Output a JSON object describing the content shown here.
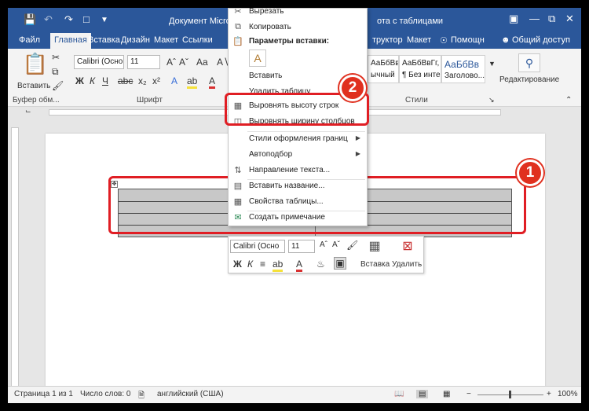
{
  "titlebar": {
    "title_left": "Документ Microsoft Word",
    "title_right": "а с таблицами",
    "tools_prefix": "ота с таблицами"
  },
  "tabs": {
    "file": "Файл",
    "home": "Главная",
    "insert": "Вставка",
    "design": "Дизайн",
    "layout": "Макет",
    "refs": "Ссылки",
    "constructor": "труктор",
    "layout2": "Макет",
    "help": "Помощн",
    "share": "Общий доступ"
  },
  "ribbon": {
    "paste_label": "Вставить",
    "clipboard_group": "Буфер обм...",
    "font_group": "Шрифт",
    "styles_group": "Стили",
    "font_name": "Calibri (Осно",
    "font_size": "11",
    "styles": [
      {
        "preview": "АаБбВвГг,",
        "name": "ычный"
      },
      {
        "preview": "АаБбВвГг,",
        "name": "¶ Без инте..."
      },
      {
        "preview": "АаБбВв",
        "name": "Заголово..."
      }
    ],
    "edit_label": "Редактирование"
  },
  "context_menu": {
    "items": [
      {
        "icon": "scissors-icon",
        "label": "Вырезать"
      },
      {
        "icon": "copy-icon",
        "label": "Копировать"
      },
      {
        "icon": "paste-icon",
        "label": "Параметры вставки:"
      },
      {
        "icon": "paste-option-icon",
        "label": "A"
      },
      {
        "icon": "",
        "label": "Вставить"
      },
      {
        "icon": "",
        "label": "Удалить таблицу"
      },
      {
        "icon": "equal-rows-icon",
        "label": "Выровнять высоту строк"
      },
      {
        "icon": "equal-cols-icon",
        "label": "Выровнять ширину столбцов"
      },
      {
        "icon": "",
        "label": "Стили оформления границ"
      },
      {
        "icon": "",
        "label": "Автоподбор"
      },
      {
        "icon": "text-direction-icon",
        "label": "Направление текста..."
      },
      {
        "icon": "insert-caption-icon",
        "label": "Вставить название..."
      },
      {
        "icon": "table-props-icon",
        "label": "Свойства таблицы..."
      },
      {
        "icon": "comment-icon",
        "label": "Создать примечание"
      }
    ]
  },
  "mini_toolbar": {
    "font_name": "Calibri (Осно",
    "font_size": "11",
    "insert_label": "Вставка",
    "delete_label": "Удалить"
  },
  "callouts": {
    "one": "1",
    "two": "2"
  },
  "status": {
    "page": "Страница 1 из 1",
    "words": "Число слов: 0",
    "lang": "английский (США)",
    "zoom": "100%"
  },
  "colors": {
    "word_blue": "#2b579a",
    "highlight_red": "#e01e24"
  }
}
